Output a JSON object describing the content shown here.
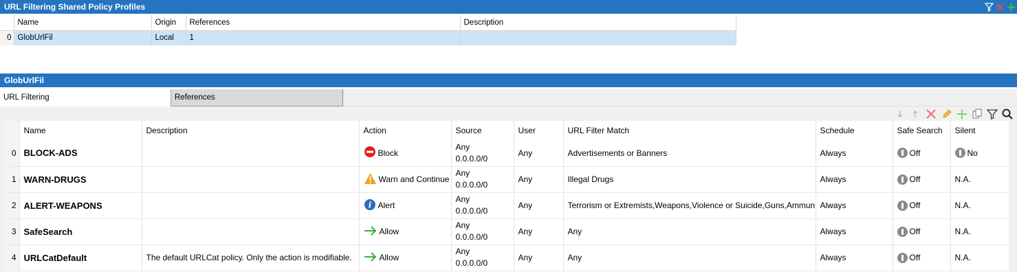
{
  "profiles_panel": {
    "title": "URL Filtering Shared Policy Profiles",
    "columns": [
      "Name",
      "Origin",
      "References",
      "Description"
    ],
    "rows": [
      {
        "index": "0",
        "name": "GlobUrlFil",
        "origin": "Local",
        "references": "1",
        "description": ""
      }
    ]
  },
  "detail_panel": {
    "title": "GlobUrlFil",
    "tabs": [
      {
        "label": "URL Filtering",
        "active": true
      },
      {
        "label": "References",
        "active": false
      }
    ]
  },
  "toolbar": {
    "icons": [
      "arrow-down-icon",
      "arrow-up-icon",
      "delete-icon",
      "edit-icon",
      "add-icon",
      "copy-icon",
      "filter-icon",
      "search-icon"
    ]
  },
  "rules_table": {
    "columns": [
      "Name",
      "Description",
      "Action",
      "Source",
      "User",
      "URL Filter Match",
      "Schedule",
      "Safe Search",
      "Silent"
    ],
    "rows": [
      {
        "index": "0",
        "name": "BLOCK-ADS",
        "description": "",
        "action": "Block",
        "action_icon": "block-icon",
        "source_line1": "Any",
        "source_line2": "0.0.0.0/0",
        "user": "Any",
        "url_match": "Advertisements or Banners",
        "schedule": "Always",
        "safe_search": "Off",
        "silent": "No",
        "silent_toggle": true
      },
      {
        "index": "1",
        "name": "WARN-DRUGS",
        "description": "",
        "action": "Warn and Continue",
        "action_icon": "warning-icon",
        "source_line1": "Any",
        "source_line2": "0.0.0.0/0",
        "user": "Any",
        "url_match": "Illegal Drugs",
        "schedule": "Always",
        "safe_search": "Off",
        "silent": "N.A.",
        "silent_toggle": false
      },
      {
        "index": "2",
        "name": "ALERT-WEAPONS",
        "description": "",
        "action": "Alert",
        "action_icon": "info-icon",
        "source_line1": "Any",
        "source_line2": "0.0.0.0/0",
        "user": "Any",
        "url_match": "Terrorism or Extremists,Weapons,Violence or Suicide,Guns,Ammun...",
        "schedule": "Always",
        "safe_search": "Off",
        "silent": "N.A.",
        "silent_toggle": false
      },
      {
        "index": "3",
        "name": "SafeSearch",
        "description": "",
        "action": "Allow",
        "action_icon": "allow-arrow-icon",
        "source_line1": "Any",
        "source_line2": "0.0.0.0/0",
        "user": "Any",
        "url_match": "Any",
        "schedule": "Always",
        "safe_search": "Off",
        "silent": "N.A.",
        "silent_toggle": false
      },
      {
        "index": "4",
        "name": "URLCatDefault",
        "description": "The default URLCat policy. Only the action is modifiable.",
        "action": "Allow",
        "action_icon": "allow-arrow-icon",
        "source_line1": "Any",
        "source_line2": "0.0.0.0/0",
        "user": "Any",
        "url_match": "Any",
        "schedule": "Always",
        "safe_search": "Off",
        "silent": "N.A.",
        "silent_toggle": false
      }
    ]
  },
  "colors": {
    "titlebar": "#2574c0",
    "selected_row": "#cce4f7",
    "block": "#e02020",
    "warning": "#f0a020",
    "info": "#2a6bc0",
    "allow": "#34b234"
  }
}
